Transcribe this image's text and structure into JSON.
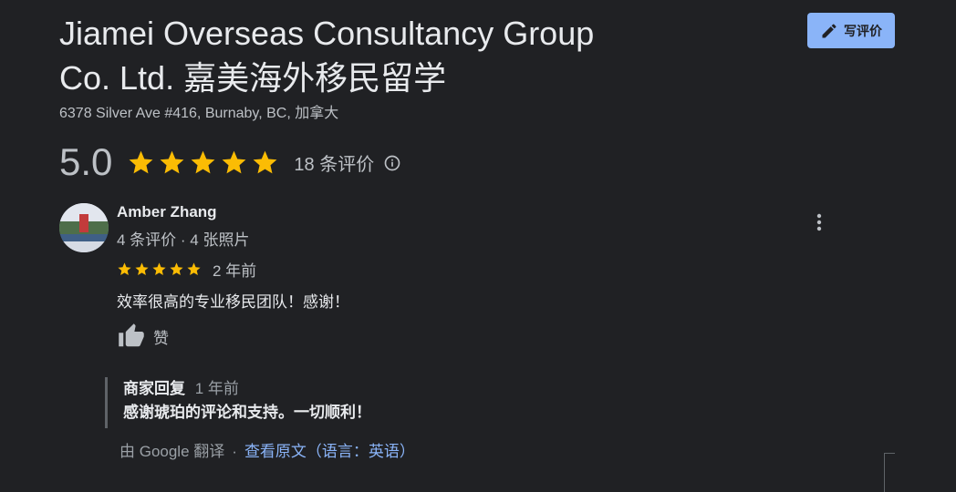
{
  "business": {
    "name_line1": "Jiamei Overseas Consultancy Group",
    "name_line2": "Co. Ltd. 嘉美海外移民留学",
    "address": "6378 Silver Ave #416, Burnaby, BC, 加拿大"
  },
  "write_review": {
    "label": "写评价",
    "icon": "pencil-icon"
  },
  "rating": {
    "value": "5.0",
    "stars": 5,
    "count_label": "18 条评价",
    "info_icon": "info-icon"
  },
  "review": {
    "author": "Amber Zhang",
    "meta": "4 条评价 · 4 张照片",
    "stars": 5,
    "time": "2 年前",
    "text": "效率很高的专业移民团队！感谢！",
    "like_label": "赞"
  },
  "owner_reply": {
    "owner_label": "商家回复",
    "time": "1 年前",
    "text": "感谢琥珀的评论和支持。一切顺利！"
  },
  "translation": {
    "by": "由 Google 翻译",
    "separator": "·",
    "view_original": "查看原文（语言：英语）"
  },
  "colors": {
    "background": "#202124",
    "star": "#fbbc04",
    "accent": "#8ab4f8",
    "text": "#e8eaed",
    "muted": "#bdc1c6"
  }
}
